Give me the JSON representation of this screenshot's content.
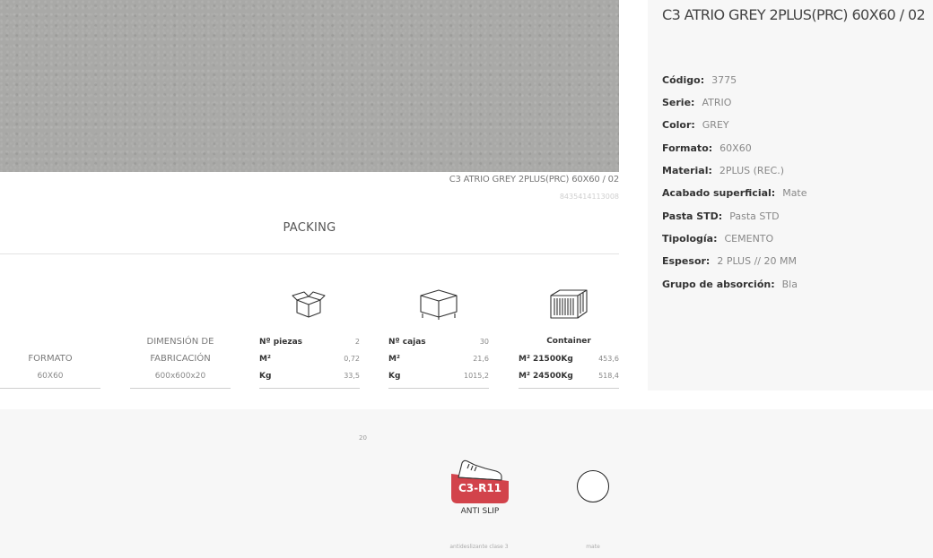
{
  "hero": {
    "caption": "C3 ATRIO GREY 2PLUS(PRC) 60X60 / 02",
    "ean": "8435414113008"
  },
  "packing": {
    "title": "PACKING",
    "formato": {
      "label": "FORMATO",
      "value": "60X60"
    },
    "dimension": {
      "label_line1": "DIMENSIÓN DE",
      "label_line2": "FABRICACIÓN",
      "value": "600x600x20"
    },
    "box": {
      "icon": "open-box-icon",
      "rows": [
        {
          "k": "Nº piezas",
          "v": "2"
        },
        {
          "k": "M²",
          "v": "0,72"
        },
        {
          "k": "Kg",
          "v": "33,5"
        }
      ]
    },
    "pallet": {
      "icon": "pallet-icon",
      "rows": [
        {
          "k": "Nº cajas",
          "v": "30"
        },
        {
          "k": "M²",
          "v": "21,6"
        },
        {
          "k": "Kg",
          "v": "1015,2"
        }
      ]
    },
    "container": {
      "icon": "shipping-container-icon",
      "title": "Container",
      "rows": [
        {
          "k": "M² 21500Kg",
          "v": "453,6"
        },
        {
          "k": "M² 24500Kg",
          "v": "518,4"
        }
      ]
    }
  },
  "product": {
    "title": "C3 ATRIO GREY 2PLUS(PRC) 60X60 / 02",
    "specs": [
      {
        "k": "Código:",
        "v": "3775"
      },
      {
        "k": "Serie:",
        "v": "ATRIO"
      },
      {
        "k": "Color:",
        "v": "GREY"
      },
      {
        "k": "Formato:",
        "v": "60X60"
      },
      {
        "k": "Material:",
        "v": "2PLUS (REC.)"
      },
      {
        "k": "Acabado superficial:",
        "v": "Mate"
      },
      {
        "k": "Pasta STD:",
        "v": "Pasta STD"
      },
      {
        "k": "Tipología:",
        "v": "CEMENTO"
      },
      {
        "k": "Espesor:",
        "v": "2 PLUS // 20 MM"
      },
      {
        "k": "Grupo de absorción:",
        "v": "Bla"
      }
    ]
  },
  "features": {
    "thickness": "20",
    "anti_slip": {
      "icon": "anti-slip-shoe-icon",
      "badge": "C3-R11",
      "label": "ANTI SLIP",
      "caption": "antideslizante clase 3",
      "color": "#d2434b"
    },
    "finish": {
      "icon": "matte-circle-icon",
      "caption": "mate"
    }
  }
}
